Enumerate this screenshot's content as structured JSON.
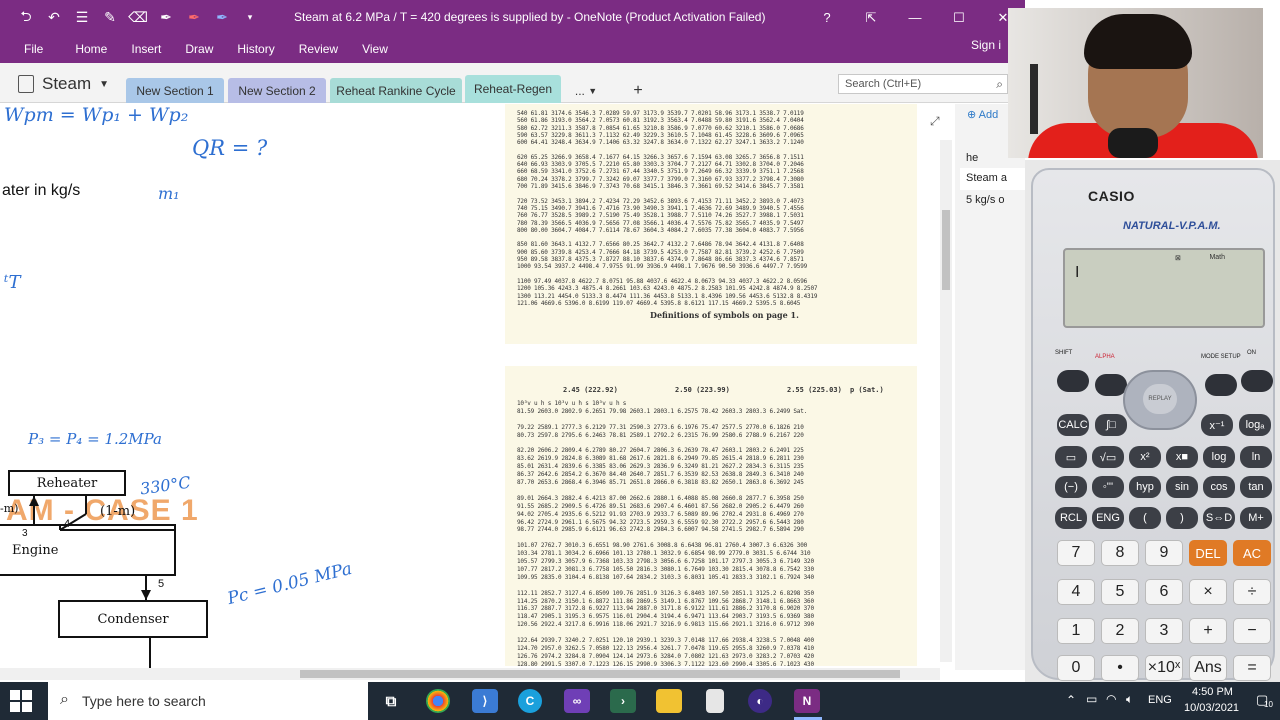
{
  "window": {
    "title": "Steam at 6.2 MPa / T = 420 degrees is supplied by  - OneNote (Product Activation Failed)",
    "help": "?",
    "buttons": [
      "minimize",
      "maximize",
      "close"
    ]
  },
  "ribbon": {
    "tabs": [
      "File",
      "Home",
      "Insert",
      "Draw",
      "History",
      "Review",
      "View"
    ],
    "signin": "Sign i"
  },
  "notebook": {
    "name": "Steam",
    "sections": [
      "New Section 1",
      "New Section 2",
      "Reheat Rankine Cycle",
      "Reheat-Regen",
      "...",
      "+"
    ],
    "active_section": "Reheat-Regen",
    "search_placeholder": "Search (Ctrl+E)"
  },
  "pages_panel": {
    "add_label": "Add",
    "pages": [
      "he",
      "Steam a",
      "5 kg/s o"
    ],
    "selected": "Steam a"
  },
  "canvas": {
    "ink_wp": "Wpт = Wp₁ + Wp₂",
    "ink_qr": "QR = ?",
    "typed_kgs": "ater in kg/s",
    "ink_m1": "m₁",
    "ink_t": "ᵗT",
    "case_title": "AM - CASE 1",
    "ink_p3": "P₃ = P₄ = 1.2MPa",
    "ink_330": "330°C",
    "ink_1m_left": "-m)",
    "ink_pc": "Pc = 0.05 MPa",
    "box_reheater": "Reheater",
    "box_engine": "Engine",
    "box_condenser": "Condenser",
    "label_1m": "(1-m)",
    "label_3": "3",
    "label_4": "4",
    "label_5": "5"
  },
  "table_top": {
    "rows": [
      "540  61.81 3174.6 3546.3 7.0289   59.97 3173.9 3539.7 7.0201   58.96 3173.1 3538.7 7.0119",
      "560  61.86 3193.0 3564.2 7.0573   60.81 3192.3 3563.4 7.0488   59.80 3191.6 3562.4 7.0404",
      "580  62.72 3211.3 3587.8 7.0854   61.65 3210.8 3586.9 7.0770   60.62 3210.1 3586.0 7.0686",
      "590  63.57 3229.8 3611.3 7.1132   62.49 3229.3 3610.5 7.1048   61.45 3228.6 3609.6 7.0965",
      "600  64.41 3248.4 3634.9 7.1406   63.32 3247.8 3634.0 7.1322   62.27 3247.1 3633.2 7.1240",
      "",
      "620  65.25 3266.9 3658.4 7.1677   64.15 3266.3 3657.6 7.1594   63.08 3265.7 3656.8 7.1511",
      "640  66.93 3303.9 3705.5 7.2210   65.80 3303.3 3704.7 7.2127   64.71 3302.8 3704.0 7.2046",
      "660  68.59 3341.0 3752.6 7.2731   67.44 3340.5 3751.9 7.2649   66.32 3339.9 3751.1 7.2568",
      "680  70.24 3378.2 3799.7 7.3242   69.07 3377.7 3799.0 7.3160   67.93 3377.2 3798.4 7.3080",
      "700  71.89 3415.6 3846.9 7.3743   70.68 3415.1 3846.3 7.3661   69.52 3414.6 3845.7 7.3581",
      "",
      "720  73.52 3453.1 3894.2 7.4234   72.29 3452.6 3893.6 7.4153   71.11 3452.2 3893.0 7.4073",
      "740  75.15 3490.7 3941.6 7.4716   73.90 3490.3 3941.1 7.4636   72.69 3489.9 3940.5 7.4556",
      "760  76.77 3528.5 3989.2 7.5190   75.49 3528.1 3988.7 7.5110   74.26 3527.7 3988.1 7.5031",
      "780  78.39 3566.5 4036.9 7.5656   77.08 3566.1 4036.4 7.5576   75.82 3565.7 4035.9 7.5497",
      "800  80.00 3604.7 4084.7 7.6114   78.67 3604.3 4084.2 7.6035   77.38 3604.0 4083.7 7.5956",
      "",
      "850  81.60 3643.1 4132.7 7.6566   80.25 3642.7 4132.2 7.6486   78.94 3642.4 4131.8 7.6408",
      "900  85.60 3739.8 4253.4 7.7666   84.18 3739.5 4253.0 7.7587   82.81 3739.2 4252.6 7.7509",
      "950  89.58 3837.8 4375.3 7.8727   88.10 3837.6 4374.9 7.8648   86.66 3837.3 4374.6 7.8571",
      "1000 93.54 3937.2 4498.4 7.9755   91.99 3936.9 4498.1 7.9676   90.50 3936.6 4497.7 7.9599",
      "",
      "1100 97.49 4037.8 4622.7 8.0751   95.88 4037.6 4622.4 8.0673   94.33 4037.3 4622.2 8.0596",
      "1200 105.36 4243.3 4875.4 8.2661  103.63 4243.0 4875.2 8.2583  101.95 4242.8 4874.9 8.2507",
      "1300 113.21 4454.0 5133.3 8.4474  111.36 4453.8 5133.1 8.4396  109.56 4453.6 5132.8 8.4319",
      "     121.06 4669.6 5396.0 8.6199  119.07 4669.4 5395.8 8.6121  117.15 4669.2 5395.5 8.6045"
    ],
    "caption": "Definitions of symbols on page 1."
  },
  "table_bottom": {
    "headers": [
      "2.45 (222.92)",
      "2.50 (223.99)",
      "2.55 (225.03)",
      "p (Sat.)"
    ],
    "rows": [
      "10³v   u      h      s     10³v   u      h      s     10³v   u      h      s",
      "81.59 2603.0 2802.9 6.2651  79.98 2603.1 2803.1 6.2575  78.42 2603.3 2803.3 6.2499 Sat.",
      "",
      "79.22 2589.1 2777.3 6.2129  77.31 2590.3 2773.6 6.1976  75.47 2577.5 2770.0 6.1826 210",
      "80.73 2597.8 2795.6 6.2463  78.81 2589.1 2792.2 6.2315  76.99 2580.6 2788.9 6.2167 220",
      "",
      "82.20 2606.2 2809.4 6.2789  80.27 2604.7 2806.3 6.2639  78.47 2603.1 2803.2 6.2491 225",
      "83.62 2619.9 2824.8 6.3089  81.68 2617.6 2821.8 6.2949  79.85 2615.4 2818.9 6.2811 230",
      "85.01 2631.4 2839.6 6.3385  83.06 2629.3 2836.9 6.3249  81.21 2627.2 2834.3 6.3115 235",
      "86.37 2642.6 2854.2 6.3670  84.40 2640.7 2851.7 6.3539  82.53 2638.8 2849.3 6.3410 240",
      "87.70 2653.6 2868.4 6.3946  85.71 2651.8 2866.0 6.3818  83.82 2650.1 2863.8 6.3692 245",
      "",
      "89.01 2664.3 2882.4 6.4213  87.00 2662.6 2880.1 6.4088  85.08 2660.8 2877.7 6.3958 250",
      "91.55 2685.2 2909.5 6.4726  89.51 2683.6 2907.4 6.4601  87.56 2682.0 2905.2 6.4479 260",
      "94.02 2705.4 2935.6 6.5212  91.93 2703.9 2933.7 6.5089  89.96 2702.4 2931.8 6.4969 270",
      "96.42 2724.9 2961.1 6.5675  94.32 2723.5 2959.3 6.5559  92.30 2722.2 2957.6 6.5443 280",
      "98.77 2744.0 2985.9 6.6121  96.63 2742.8 2984.3 6.6007  94.58 2741.5 2982.7 6.5894 290",
      "",
      "101.07 2762.7 3010.3 6.6551  98.90 2761.6 3008.8 6.6438  96.81 2760.4 3007.3 6.6326 300",
      "103.34 2781.1 3034.2 6.6966 101.13 2780.1 3032.9 6.6854  98.99 2779.0 3031.5 6.6744 310",
      "105.57 2799.3 3057.9 6.7368 103.33 2798.3 3056.6 6.7258 101.17 2797.3 3055.3 6.7149 320",
      "107.77 2817.2 3081.3 6.7758 105.50 2816.3 3080.1 6.7649 103.30 2815.4 3078.8 6.7542 330",
      "109.95 2835.0 3104.4 6.8138 107.64 2834.2 3103.3 6.8031 105.41 2833.3 3102.1 6.7924 340",
      "",
      "112.11 2852.7 3127.4 6.8509 109.76 2851.9 3126.3 6.8403 107.50 2851.1 3125.2 6.8298 350",
      "114.25 2870.2 3150.1 6.8872 111.86 2869.5 3149.1 6.8767 109.56 2868.7 3148.1 6.8663 360",
      "116.37 2887.7 3172.8 6.9227 113.94 2887.0 3171.8 6.9122 111.61 2886.2 3170.8 6.9020 370",
      "118.47 2905.1 3195.3 6.9575 116.01 2904.4 3194.4 6.9471 113.64 2903.7 3193.5 6.9369 380",
      "120.56 2922.4 3217.8 6.9916 118.06 2921.7 3216.9 6.9813 115.66 2921.1 3216.0 6.9712 390",
      "",
      "122.64 2939.7 3240.2 7.0251 120.10 2939.1 3239.3 7.0148 117.66 2938.4 3238.5 7.0048 400",
      "124.70 2957.0 3262.5 7.0580 122.13 2956.4 3261.7 7.0478 119.65 2955.8 3260.9 7.0378 410",
      "126.76 2974.2 3284.8 7.0904 124.14 2973.6 3284.0 7.0802 121.63 2973.0 3283.2 7.0703 420",
      "128.80 2991.5 3307.0 7.1223 126.15 2990.9 3306.3 7.1122 123.60 2990.4 3305.6 7.1023 430"
    ]
  },
  "calculator": {
    "brand": "CASIO",
    "model": "NATURAL-V.P.A.M.",
    "display_mode": "Math",
    "display_indicator": "⊠",
    "cursor": "I",
    "labels": {
      "shift": "SHIFT",
      "alpha": "ALPHA",
      "mode": "MODE SETUP",
      "on": "ON",
      "replay": "REPLAY"
    },
    "row1": [
      "CALC",
      "∫□",
      "x⁻¹",
      "logₐ"
    ],
    "row2": [
      "▭",
      "√▭",
      "x²",
      "x■",
      "log",
      "ln"
    ],
    "row3": [
      "(−)",
      "◦'''",
      "hyp",
      "sin",
      "cos",
      "tan"
    ],
    "row4": [
      "RCL",
      "ENG",
      "(",
      ")",
      "S⇔D",
      "M+"
    ],
    "numrow1": [
      "7",
      "8",
      "9",
      "DEL",
      "AC"
    ],
    "numrow2": [
      "4",
      "5",
      "6",
      "×",
      "÷"
    ],
    "numrow3": [
      "1",
      "2",
      "3",
      "+",
      "−"
    ],
    "numrow4": [
      "0",
      "•",
      "×10ˣ",
      "Ans",
      "="
    ]
  },
  "taskbar": {
    "search_placeholder": "Type here to search",
    "apps": [
      "task-view",
      "chrome",
      "visual-studio-code",
      "c-app",
      "visual-studio",
      "terminal",
      "file-explorer",
      "notepad",
      "eclipse",
      "onenote"
    ],
    "time": "4:50 PM",
    "date": "10/03/2021",
    "lang": "ENG",
    "notifications": "10"
  },
  "colors": {
    "onenote_purple": "#7b2c83",
    "ink_blue": "#2e6fd1",
    "case_orange": "#f0a86b",
    "calc_orange": "#e07a25",
    "taskbar": "#1f2a36"
  }
}
